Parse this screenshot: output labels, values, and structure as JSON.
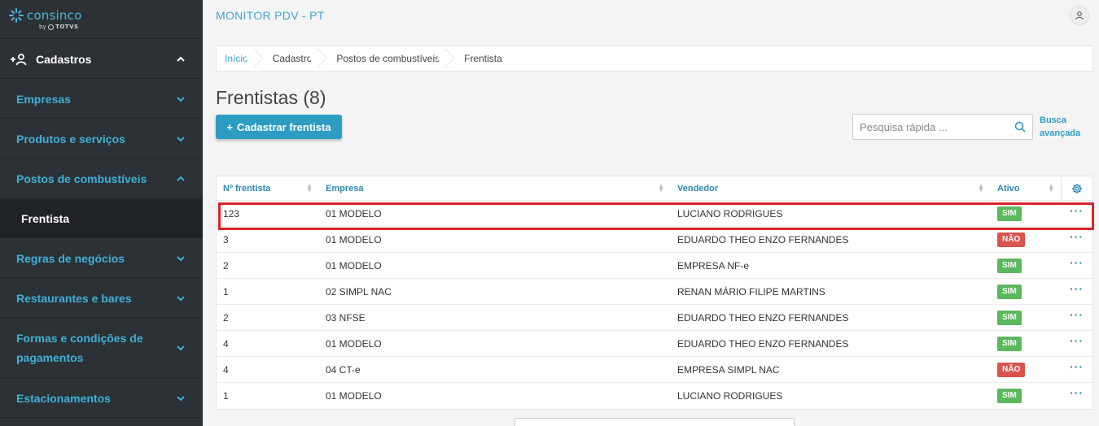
{
  "brand": {
    "name": "consinco",
    "by": "by",
    "sub": "TOTVS"
  },
  "sidebar": {
    "header": "Cadastros",
    "items": [
      {
        "label": "Empresas"
      },
      {
        "label": "Produtos e serviços"
      },
      {
        "label": "Postos de combustíveis"
      },
      {
        "label": "Frentista"
      },
      {
        "label": "Regras de negócios"
      },
      {
        "label": "Restaurantes e bares"
      },
      {
        "label": "Formas e condições de pagamentos"
      },
      {
        "label": "Estacionamentos"
      }
    ]
  },
  "header": {
    "title": "MONITOR PDV - PT"
  },
  "breadcrumb": [
    "Início",
    "Cadastro",
    "Postos de combustíveis",
    "Frentista"
  ],
  "page": {
    "title": "Frentistas (8)",
    "add_button": "Cadastrar frentista"
  },
  "search": {
    "placeholder": "Pesquisa rápida ...",
    "advanced_line1": "Busca",
    "advanced_line2": "avançada"
  },
  "table": {
    "columns": [
      "Nº frentista",
      "Empresa",
      "Vendedor",
      "Ativo"
    ],
    "rows": [
      {
        "num": "123",
        "empresa": "01 MODELO",
        "vendedor": "LUCIANO RODRIGUES",
        "ativo": "SIM"
      },
      {
        "num": "3",
        "empresa": "01 MODELO",
        "vendedor": "EDUARDO THEO ENZO FERNANDES",
        "ativo": "NÃO"
      },
      {
        "num": "2",
        "empresa": "01 MODELO",
        "vendedor": "EMPRESA NF-e",
        "ativo": "SIM"
      },
      {
        "num": "1",
        "empresa": "02 SIMPL NAC",
        "vendedor": "RENAN MÁRIO FILIPE MARTINS",
        "ativo": "SIM"
      },
      {
        "num": "2",
        "empresa": "03 NFSE",
        "vendedor": "EDUARDO THEO ENZO FERNANDES",
        "ativo": "SIM"
      },
      {
        "num": "4",
        "empresa": "01 MODELO",
        "vendedor": "EDUARDO THEO ENZO FERNANDES",
        "ativo": "SIM"
      },
      {
        "num": "4",
        "empresa": "04 CT-e",
        "vendedor": "EMPRESA SIMPL NAC",
        "ativo": "NÃO"
      },
      {
        "num": "1",
        "empresa": "01 MODELO",
        "vendedor": "LUCIANO RODRIGUES",
        "ativo": "SIM"
      }
    ]
  },
  "colors": {
    "accent": "#2d9cc3",
    "sidebar_bg": "#2c3135",
    "sim": "#5cb85c",
    "nao": "#d9534f",
    "highlight": "#d9232a"
  }
}
